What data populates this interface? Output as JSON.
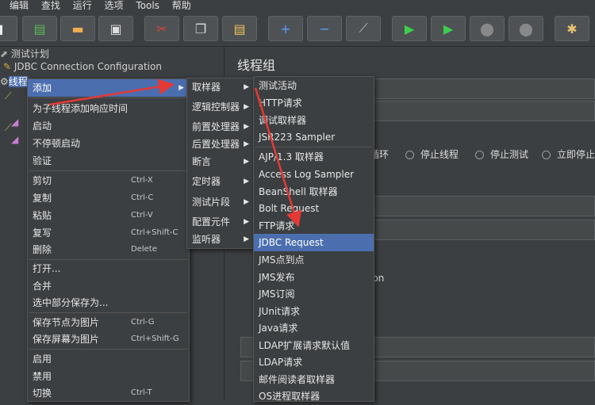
{
  "menubar": {
    "items": [
      "编辑",
      "查找",
      "运行",
      "选项",
      "Tools",
      "帮助"
    ]
  },
  "tree": {
    "test_plan": "测试计划",
    "jdbc_config": "JDBC Connection Configuration",
    "thread_group_fragment": "线程"
  },
  "right_panel": {
    "title": "线程组",
    "radio_options": [
      "循环",
      "停止线程",
      "停止测试",
      "立即停止"
    ],
    "partial_text_1": "ion"
  },
  "context_menu": {
    "items": [
      {
        "label": "添加",
        "shortcut": "",
        "submenu": true
      },
      {
        "label": "为子线程添加响应时间",
        "shortcut": ""
      },
      {
        "label": "启动",
        "shortcut": ""
      },
      {
        "label": "不停顿启动",
        "shortcut": ""
      },
      {
        "label": "验证",
        "shortcut": ""
      },
      {
        "label": "剪切",
        "shortcut": "Ctrl-X"
      },
      {
        "label": "复制",
        "shortcut": "Ctrl-C"
      },
      {
        "label": "粘贴",
        "shortcut": "Ctrl-V"
      },
      {
        "label": "复写",
        "shortcut": "Ctrl+Shift-C"
      },
      {
        "label": "删除",
        "shortcut": "Delete"
      },
      {
        "label": "打开...",
        "shortcut": ""
      },
      {
        "label": "合并",
        "shortcut": ""
      },
      {
        "label": "选中部分保存为...",
        "shortcut": ""
      },
      {
        "label": "保存节点为图片",
        "shortcut": "Ctrl-G"
      },
      {
        "label": "保存屏幕为图片",
        "shortcut": "Ctrl+Shift-G"
      },
      {
        "label": "启用",
        "shortcut": ""
      },
      {
        "label": "禁用",
        "shortcut": ""
      },
      {
        "label": "切换",
        "shortcut": "Ctrl-T"
      }
    ]
  },
  "add_submenu": {
    "items": [
      "取样器",
      "逻辑控制器",
      "前置处理器",
      "后置处理器",
      "断言",
      "定时器",
      "测试片段",
      "配置元件",
      "监听器"
    ]
  },
  "sampler_submenu": {
    "items": [
      "测试活动",
      "HTTP请求",
      "调试取样器",
      "JSR223 Sampler",
      "AJP/1.3 取样器",
      "Access Log Sampler",
      "BeanShell 取样器",
      "Bolt Request",
      "FTP请求",
      "JDBC Request",
      "JMS点到点",
      "JMS发布",
      "JMS订阅",
      "JUnit请求",
      "Java请求",
      "LDAP扩展请求默认值",
      "LDAP请求",
      "邮件阅读者取样器",
      "OS进程取样器"
    ],
    "highlighted": "JDBC Request"
  },
  "colors": {
    "background": "#3c3f41",
    "highlight": "#4b6eaf",
    "arrow": "#e53935"
  }
}
